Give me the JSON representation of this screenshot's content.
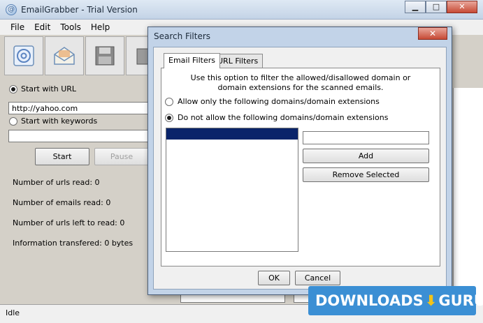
{
  "window": {
    "title": "EmailGrabber - Trial Version",
    "minimize": "▁",
    "maximize": "□",
    "close": "✕"
  },
  "menu": [
    "File",
    "Edit",
    "Tools",
    "Help"
  ],
  "toolbar": {
    "icons": [
      "at-sign-email-icon",
      "open-envelope-icon",
      "save-disk-icon",
      "extra-icon"
    ]
  },
  "source": {
    "url_option_label": "Start with URL",
    "url_value": "http://yahoo.com",
    "keywords_option_label": "Start with keywords",
    "keywords_value": ""
  },
  "buttons": {
    "start": "Start",
    "pause": "Pause"
  },
  "stats": [
    "Number of urls read:  0",
    "Number of emails read:  0",
    "Number of urls left to read:  0",
    "Information transfered:  0 bytes"
  ],
  "status": "Idle",
  "dialog": {
    "title": "Search Filters",
    "close": "✕",
    "tabs": [
      "Email Filters",
      "URL Filters"
    ],
    "info_line1": "Use this option to filter the allowed/disallowed domain or",
    "info_line2": "domain extensions for the scanned emails.",
    "option_allow": "Allow only the following domains/domain extensions",
    "option_disallow": "Do not allow the following domains/domain extensions",
    "domain_input_value": "",
    "add_button": "Add",
    "remove_button": "Remove Selected",
    "ok_button": "OK",
    "cancel_button": "Cancel"
  },
  "watermark": {
    "left": "DOWNLOADS",
    "right": "GURU",
    "arrow": "⬇"
  }
}
